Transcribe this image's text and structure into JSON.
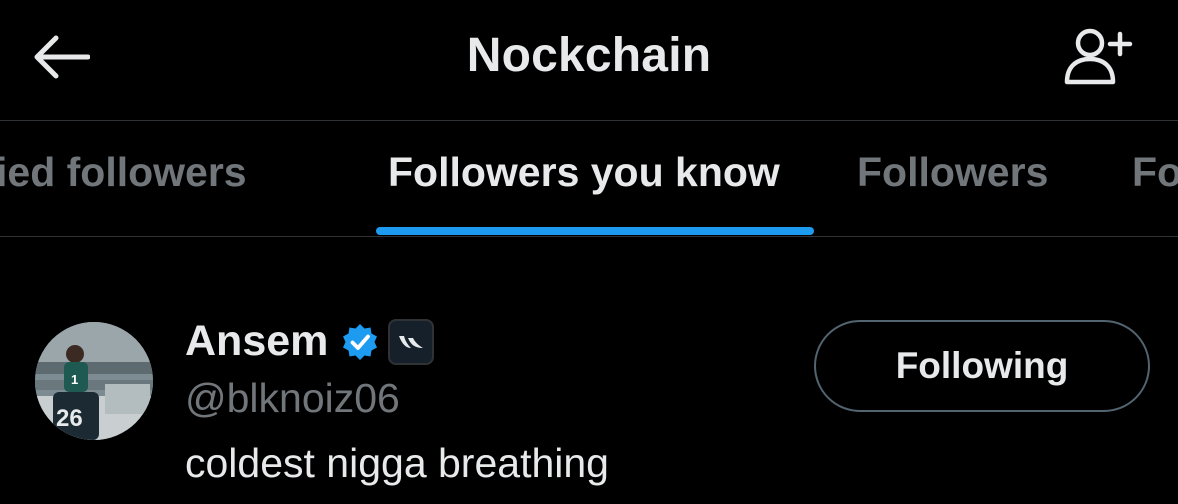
{
  "header": {
    "title": "Nockchain",
    "back_icon": "arrow-left-icon",
    "add_icon": "person-add-icon"
  },
  "tabs": [
    {
      "label": "rified followers",
      "active": false
    },
    {
      "label": "Followers you know",
      "active": true
    },
    {
      "label": "Followers",
      "active": false
    },
    {
      "label": "Fo",
      "active": false
    }
  ],
  "colors": {
    "accent": "#1d9bf0",
    "background": "#000000",
    "text_primary": "#e7e9ea",
    "text_secondary": "#71767b",
    "divider": "#2f3336"
  },
  "user": {
    "name": "Ansem",
    "handle": "@blknoiz06",
    "bio": "coldest nigga breathing",
    "verified_icon": "verified-badge-icon",
    "affiliate_icon": "affiliate-badge-icon",
    "avatar_jersey_number": "26",
    "follow_button_label": "Following"
  }
}
